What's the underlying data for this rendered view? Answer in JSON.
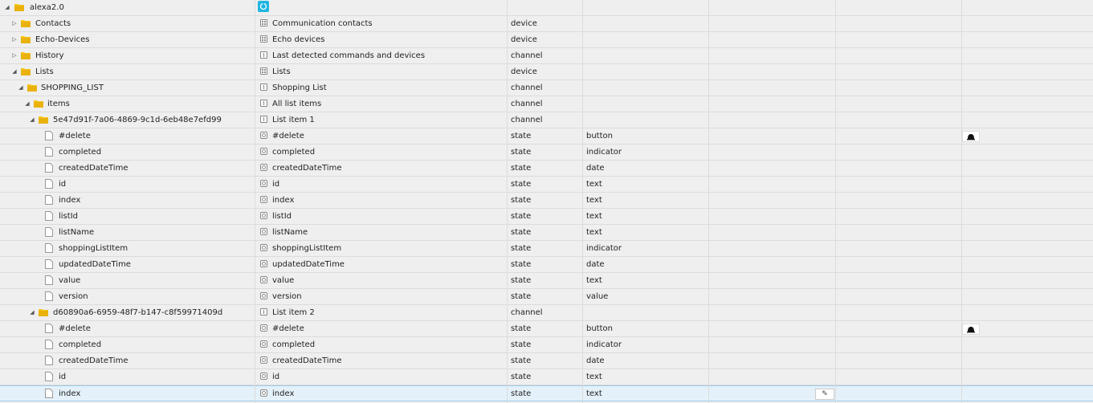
{
  "root": {
    "label": "alexa2.0",
    "expanded": true
  },
  "rows": [
    {
      "name": "Contacts",
      "desc": "Communication contacts",
      "type": "device",
      "role": "",
      "level": 1,
      "kind": "folder",
      "toggle": "collapsed",
      "icon": "device"
    },
    {
      "name": "Echo-Devices",
      "desc": "Echo devices",
      "type": "device",
      "role": "",
      "level": 1,
      "kind": "folder",
      "toggle": "collapsed",
      "icon": "device"
    },
    {
      "name": "History",
      "desc": "Last detected commands and devices",
      "type": "channel",
      "role": "",
      "level": 1,
      "kind": "folder",
      "toggle": "collapsed",
      "icon": "channel"
    },
    {
      "name": "Lists",
      "desc": "Lists",
      "type": "device",
      "role": "",
      "level": 1,
      "kind": "folder",
      "toggle": "expanded",
      "icon": "device"
    },
    {
      "name": "SHOPPING_LIST",
      "desc": "Shopping List",
      "type": "channel",
      "role": "",
      "level": 2,
      "kind": "folder",
      "toggle": "expanded",
      "icon": "channel"
    },
    {
      "name": "items",
      "desc": "All list items",
      "type": "channel",
      "role": "",
      "level": 3,
      "kind": "folder",
      "toggle": "expanded",
      "icon": "channel"
    },
    {
      "name": "5e47d91f-7a06-4869-9c1d-6eb48e7efd99",
      "desc": "List item 1",
      "type": "channel",
      "role": "",
      "level": 4,
      "kind": "folder",
      "toggle": "expanded",
      "icon": "channel"
    },
    {
      "name": "#delete",
      "desc": "#delete",
      "type": "state",
      "role": "button",
      "level": 5,
      "kind": "doc",
      "icon": "state",
      "button": true
    },
    {
      "name": "completed",
      "desc": "completed",
      "type": "state",
      "role": "indicator",
      "level": 5,
      "kind": "doc",
      "icon": "state"
    },
    {
      "name": "createdDateTime",
      "desc": "createdDateTime",
      "type": "state",
      "role": "date",
      "level": 5,
      "kind": "doc",
      "icon": "state"
    },
    {
      "name": "id",
      "desc": "id",
      "type": "state",
      "role": "text",
      "level": 5,
      "kind": "doc",
      "icon": "state"
    },
    {
      "name": "index",
      "desc": "index",
      "type": "state",
      "role": "text",
      "level": 5,
      "kind": "doc",
      "icon": "state"
    },
    {
      "name": "listId",
      "desc": "listId",
      "type": "state",
      "role": "text",
      "level": 5,
      "kind": "doc",
      "icon": "state"
    },
    {
      "name": "listName",
      "desc": "listName",
      "type": "state",
      "role": "text",
      "level": 5,
      "kind": "doc",
      "icon": "state"
    },
    {
      "name": "shoppingListItem",
      "desc": "shoppingListItem",
      "type": "state",
      "role": "indicator",
      "level": 5,
      "kind": "doc",
      "icon": "state"
    },
    {
      "name": "updatedDateTime",
      "desc": "updatedDateTime",
      "type": "state",
      "role": "date",
      "level": 5,
      "kind": "doc",
      "icon": "state"
    },
    {
      "name": "value",
      "desc": "value",
      "type": "state",
      "role": "text",
      "level": 5,
      "kind": "doc",
      "icon": "state"
    },
    {
      "name": "version",
      "desc": "version",
      "type": "state",
      "role": "value",
      "level": 5,
      "kind": "doc",
      "icon": "state"
    },
    {
      "name": "d60890a6-6959-48f7-b147-c8f59971409d",
      "desc": "List item 2",
      "type": "channel",
      "role": "",
      "level": 4,
      "kind": "folder",
      "toggle": "expanded",
      "icon": "channel"
    },
    {
      "name": "#delete",
      "desc": "#delete",
      "type": "state",
      "role": "button",
      "level": 5,
      "kind": "doc",
      "icon": "state",
      "button": true
    },
    {
      "name": "completed",
      "desc": "completed",
      "type": "state",
      "role": "indicator",
      "level": 5,
      "kind": "doc",
      "icon": "state"
    },
    {
      "name": "createdDateTime",
      "desc": "createdDateTime",
      "type": "state",
      "role": "date",
      "level": 5,
      "kind": "doc",
      "icon": "state"
    },
    {
      "name": "id",
      "desc": "id",
      "type": "state",
      "role": "text",
      "level": 5,
      "kind": "doc",
      "icon": "state"
    },
    {
      "name": "index",
      "desc": "index",
      "type": "state",
      "role": "text",
      "level": 5,
      "kind": "doc",
      "icon": "state",
      "selected": true,
      "edit": true
    }
  ],
  "colors": {
    "folder": "#f5c518",
    "accent": "#1fb6e0",
    "selected_row": "#e4f1fa"
  },
  "icons": {
    "expanded": "triangle-down-icon",
    "collapsed": "triangle-right-icon",
    "folder": "folder-icon",
    "doc": "file-icon",
    "button": "bell-icon",
    "edit": "pencil-icon"
  }
}
